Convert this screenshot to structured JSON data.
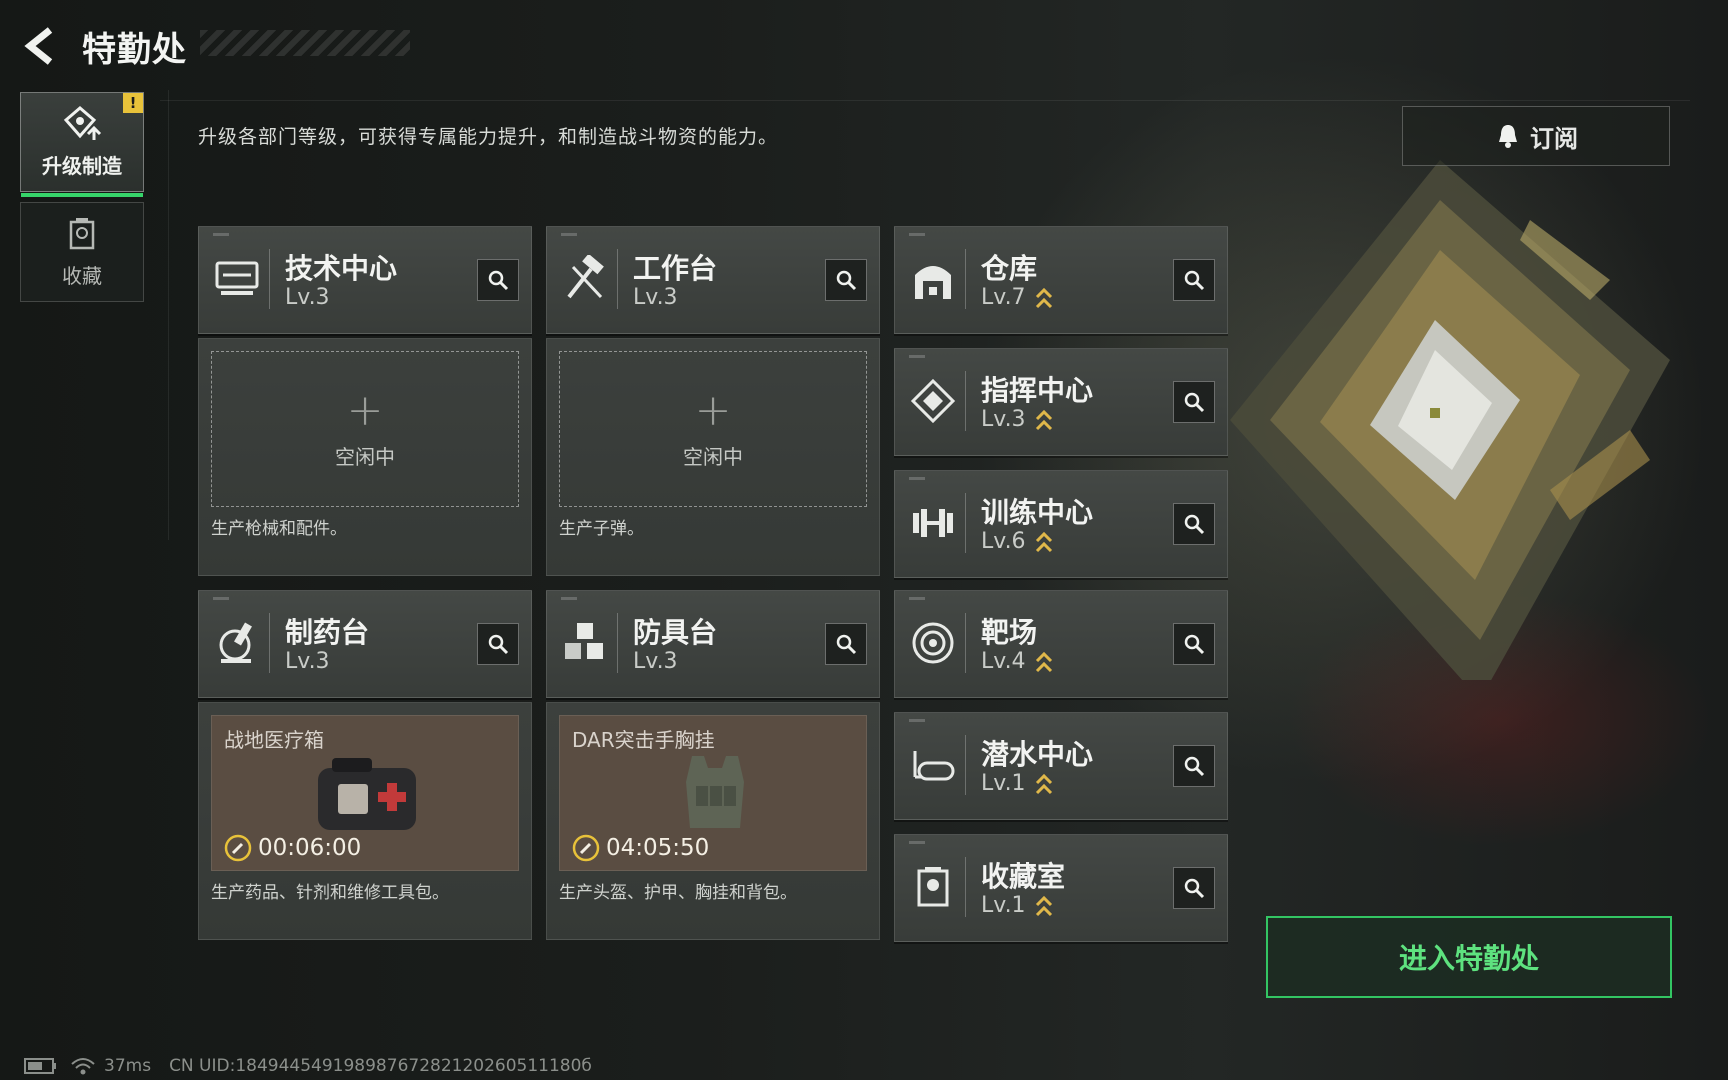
{
  "header": {
    "title": "特勤处",
    "description": "升级各部门等级，可获得专属能力提升，和制造战斗物资的能力。"
  },
  "sidebar": {
    "items": [
      {
        "label": "升级制造",
        "active": true,
        "badge": "!"
      },
      {
        "label": "收藏",
        "active": false
      }
    ]
  },
  "subscribe": {
    "label": "订阅"
  },
  "facilities": {
    "tech": {
      "name": "技术中心",
      "level": "Lv.3",
      "idle_label": "空闲中",
      "description": "生产枪械和配件。"
    },
    "workbench": {
      "name": "工作台",
      "level": "Lv.3",
      "idle_label": "空闲中",
      "description": "生产子弹。"
    },
    "pharmacy": {
      "name": "制药台",
      "level": "Lv.3",
      "item_name": "战地医疗箱",
      "timer": "00:06:00",
      "description": "生产药品、针剂和维修工具包。"
    },
    "armor": {
      "name": "防具台",
      "level": "Lv.3",
      "item_name": "DAR突击手胸挂",
      "timer": "04:05:50",
      "description": "生产头盔、护甲、胸挂和背包。"
    },
    "warehouse": {
      "name": "仓库",
      "level": "Lv.7",
      "upgradable": true
    },
    "command": {
      "name": "指挥中心",
      "level": "Lv.3",
      "upgradable": true
    },
    "training": {
      "name": "训练中心",
      "level": "Lv.6",
      "upgradable": true
    },
    "range": {
      "name": "靶场",
      "level": "Lv.4",
      "upgradable": true
    },
    "diving": {
      "name": "潜水中心",
      "level": "Lv.1",
      "upgradable": true
    },
    "collection": {
      "name": "收藏室",
      "level": "Lv.1",
      "upgradable": true
    }
  },
  "enter_button": {
    "label": "进入特勤处"
  },
  "status_bar": {
    "ping": "37ms",
    "uid": "CN UID:18494454919898767282120260511180б"
  },
  "colors": {
    "accent_green": "#36d46a",
    "upgrade_gold": "#e0b84a",
    "badge_yellow": "#e8c23a",
    "product_bg": "#5a4d42"
  }
}
